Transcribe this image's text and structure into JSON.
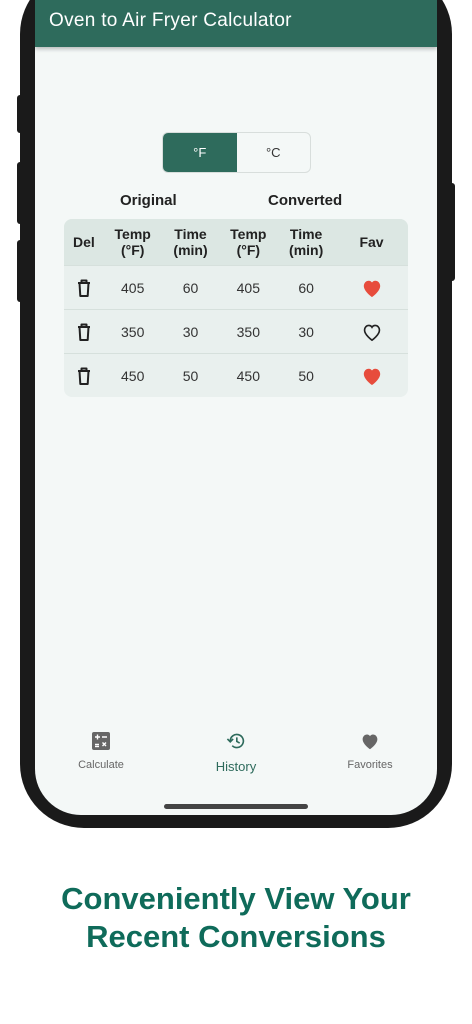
{
  "app": {
    "title": "Oven to Air Fryer Calculator"
  },
  "toggle": {
    "fahrenheit": "°F",
    "celsius": "°C",
    "selected": "°F"
  },
  "groups": {
    "original": "Original",
    "converted": "Converted"
  },
  "table": {
    "headers": {
      "del": "Del",
      "orig_temp_1": "Temp",
      "orig_temp_2": "(°F)",
      "orig_time_1": "Time",
      "orig_time_2": "(min)",
      "conv_temp_1": "Temp",
      "conv_temp_2": "(°F)",
      "conv_time_1": "Time",
      "conv_time_2": "(min)",
      "fav": "Fav"
    },
    "rows": [
      {
        "orig_temp": "405",
        "orig_time": "60",
        "conv_temp": "405",
        "conv_time": "60",
        "favorite": true
      },
      {
        "orig_temp": "350",
        "orig_time": "30",
        "conv_temp": "350",
        "conv_time": "30",
        "favorite": false
      },
      {
        "orig_temp": "450",
        "orig_time": "50",
        "conv_temp": "450",
        "conv_time": "50",
        "favorite": true
      }
    ]
  },
  "nav": {
    "calculate": "Calculate",
    "history": "History",
    "favorites": "Favorites",
    "active": "History"
  },
  "icons": {
    "delete": "trash-icon",
    "favorite": "heart-icon",
    "calculate": "calculator-icon",
    "history": "history-icon",
    "favorites": "heart-icon"
  },
  "colors": {
    "primary": "#2e6b5c",
    "heart": "#e74c3c",
    "caption": "#0f6b5a"
  },
  "caption": {
    "line1": "Conveniently View Your",
    "line2": "Recent Conversions"
  }
}
